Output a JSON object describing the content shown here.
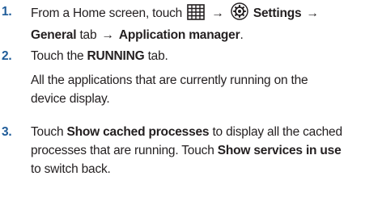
{
  "steps": [
    {
      "number": "1.",
      "line1_prefix": "From a Home screen, touch",
      "apps_icon": "apps-grid-icon",
      "arrow": "→",
      "settings_icon": "settings-gear-icon",
      "settings_label": "Settings",
      "line2_general": "General",
      "line2_tab": "tab",
      "line2_app_manager": "Application manager",
      "line2_end": "."
    },
    {
      "number": "2.",
      "line1_prefix": "Touch the",
      "running": "RUNNING",
      "line1_suffix": "tab.",
      "note_line1": "All the applications that are currently running on the",
      "note_line2": "device display."
    },
    {
      "number": "3.",
      "line1_prefix": "Touch",
      "show_cached": "Show cached processes",
      "line1_suffix": "to display all the cached",
      "line2_prefix": "processes that are running. Touch",
      "show_services": "Show services in use",
      "line3": "to switch back."
    }
  ],
  "colors": {
    "step_number": "#1f5c99",
    "text": "#231f20"
  }
}
